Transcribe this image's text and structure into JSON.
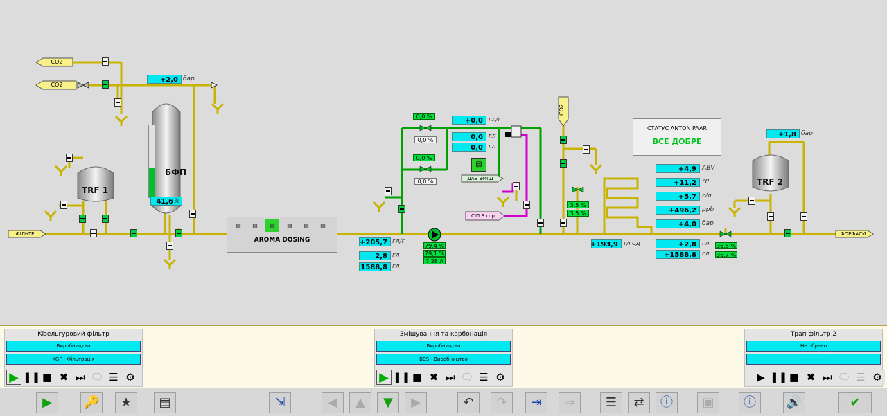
{
  "process": {
    "co2_top": "CO2",
    "co2_bottom": "CO2",
    "co2_right": "CO2",
    "filter_in": "ФІЛЬТР",
    "forfasi": "ФОРФАСИ",
    "trf1": "TRF 1",
    "trf2": "TRF 2",
    "bfp": "БФП",
    "bfp_level": "41,6",
    "bfp_level_unit": "%",
    "bfp_level_fraction": 0.416,
    "pressure_top": {
      "value": "+2,0",
      "unit": "бар"
    },
    "pressure_trf2": {
      "value": "+1,8",
      "unit": "бар"
    },
    "aroma_dosing": "AROMA DOSING",
    "sip": "СІП В гор.",
    "dav": "ДАВ ЗМІШ",
    "status_title": "СТАТУС ANTON PAAR",
    "status_value": "ВСЕ ДОБРЕ",
    "dosing": [
      {
        "green": "0,0 %",
        "gray": "0,0 %"
      },
      {
        "green": "0,0 %",
        "gray": "0,0 %"
      }
    ],
    "flow_top": [
      {
        "value": "+0,0",
        "unit": "гл/г"
      },
      {
        "value": "0,0",
        "unit": "гл"
      },
      {
        "value": "0,0",
        "unit": "гл"
      }
    ],
    "flow_main": [
      {
        "value": "+205,7",
        "unit": "гл/г"
      },
      {
        "value": "2,8",
        "unit": "гл"
      },
      {
        "value": "1588,8",
        "unit": "гл"
      }
    ],
    "pump_pcts": [
      "79,4 %",
      "79,1 %",
      "7,28 А"
    ],
    "co2_valve_pcts": [
      "3,5 %",
      "3,5 %"
    ],
    "co2_flow": {
      "value": "+193,9",
      "unit": "т/год"
    },
    "anton_paar": [
      {
        "value": "+4,9",
        "unit": "ABV"
      },
      {
        "value": "+11,2",
        "unit": "°P"
      },
      {
        "value": "+5,7",
        "unit": "г/л"
      },
      {
        "value": "+496,2",
        "unit": "ppb"
      },
      {
        "value": "+4,0",
        "unit": "бар"
      }
    ],
    "final_flow": [
      {
        "value": "+2,8",
        "unit": "гл"
      },
      {
        "value": "+1588,8",
        "unit": "гл"
      }
    ],
    "out_valve_pcts": [
      "36,5 %",
      "36,7 %"
    ]
  },
  "panels": [
    {
      "title": "Кізельгуровий фільтр",
      "status1": "Виробництво",
      "status2": "KGF - Фільтрація"
    },
    {
      "title": "Змішування та карбонація",
      "status1": "Виробництво",
      "status2": "BCS - Виробництво"
    },
    {
      "title": "Трап фільтр 2",
      "status1": "Не обрано",
      "status2": "- - - - - - - - -"
    }
  ],
  "controls": {
    "play": "▶",
    "pause": "❚❚",
    "stop": "■",
    "abort": "✖",
    "skip": "⏭",
    "chat": "🗨",
    "list": "☰",
    "ops": "⚙"
  },
  "toolbar": {
    "items": [
      {
        "name": "start-icon",
        "glyph": "▶"
      },
      {
        "name": "keys-icon",
        "glyph": "🔑"
      },
      {
        "name": "recipe-icon",
        "glyph": "★"
      },
      {
        "name": "report-icon",
        "glyph": "▤"
      },
      {
        "name": "transfer-icon",
        "glyph": "⇲"
      },
      {
        "name": "arrow-left-icon",
        "glyph": "◀"
      },
      {
        "name": "arrow-up-icon",
        "glyph": "▲"
      },
      {
        "name": "arrow-down-icon",
        "glyph": "▼"
      },
      {
        "name": "arrow-right-icon",
        "glyph": "▶"
      },
      {
        "name": "undo-icon",
        "glyph": "↶"
      },
      {
        "name": "redo-icon",
        "glyph": "↷"
      },
      {
        "name": "import-icon",
        "glyph": "⇥"
      },
      {
        "name": "export-icon",
        "glyph": "⇒"
      },
      {
        "name": "list-icon",
        "glyph": "☰"
      },
      {
        "name": "swap-icon",
        "glyph": "⇄"
      },
      {
        "name": "info-icon",
        "glyph": "ⓘ"
      },
      {
        "name": "monitor-icon",
        "glyph": "▣"
      },
      {
        "name": "help-icon",
        "glyph": "ⓘ"
      },
      {
        "name": "sound-icon",
        "glyph": "🔊"
      },
      {
        "name": "acknowledge-icon",
        "glyph": "✔"
      }
    ]
  },
  "colors": {
    "pipe_product": "#c8b400",
    "pipe_water": "#00a000",
    "pipe_cip": "#d000d0",
    "value_box": "#00e8f0",
    "active": "#00e040"
  }
}
